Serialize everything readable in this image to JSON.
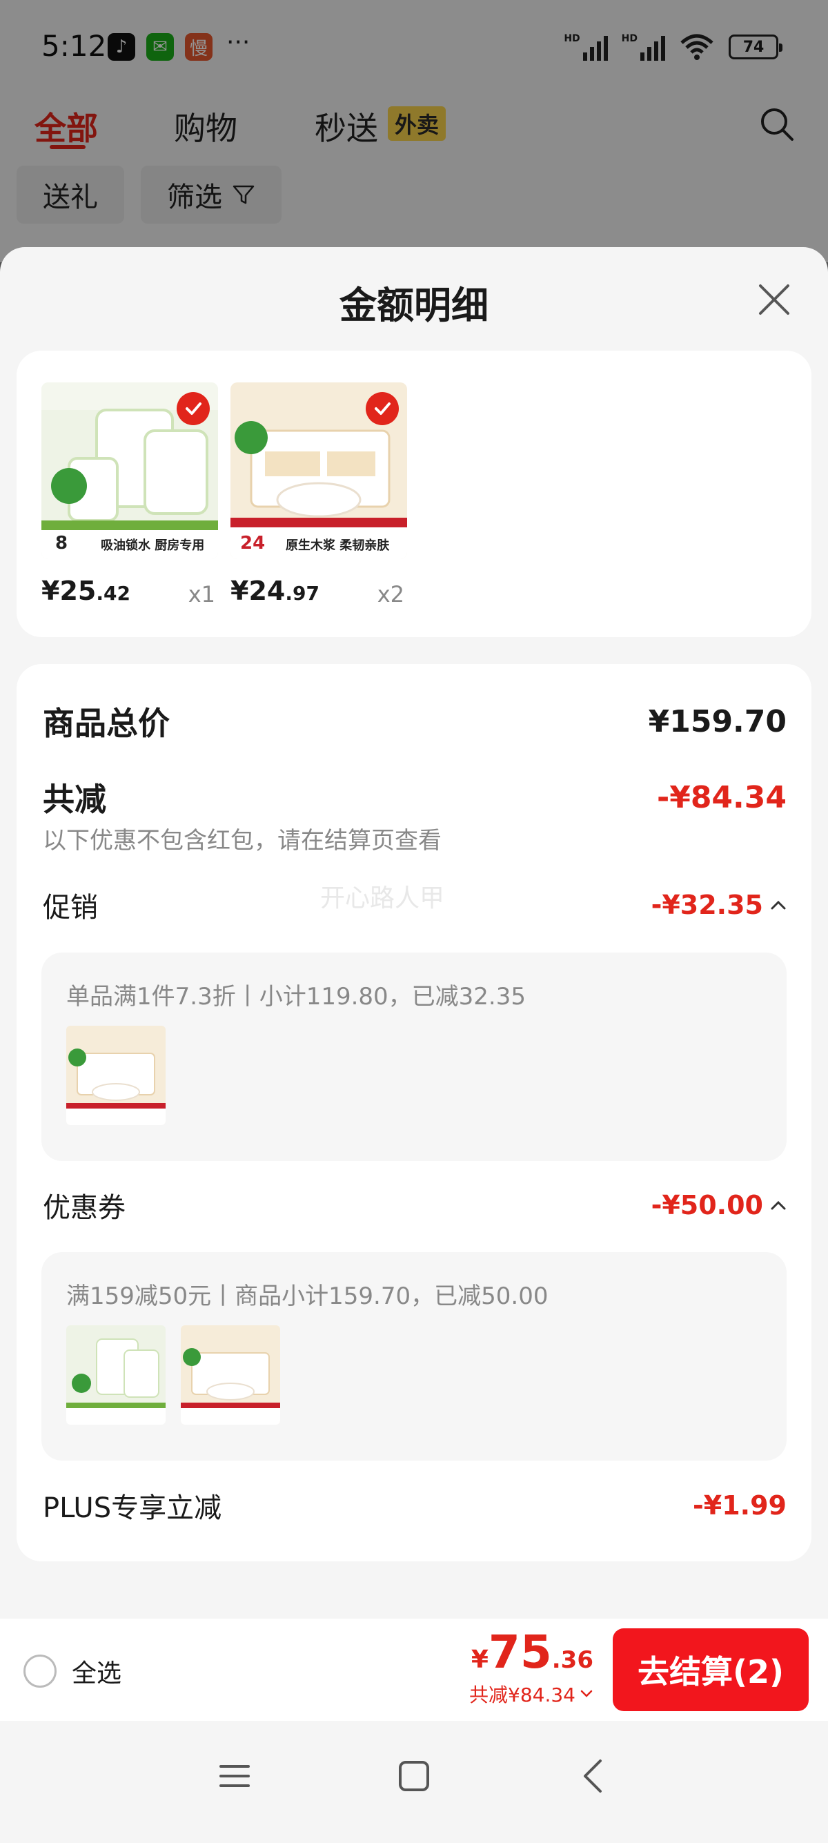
{
  "status_bar": {
    "time": "5:12",
    "apps": [
      {
        "icon": "tiktok-icon",
        "glyph": "♪"
      },
      {
        "icon": "wechat-icon",
        "glyph": "✉"
      },
      {
        "icon": "app-icon",
        "glyph": "慢"
      }
    ],
    "more": "···",
    "battery": "74"
  },
  "background_page": {
    "tabs": [
      {
        "label": "全部",
        "active": true
      },
      {
        "label": "购物",
        "active": false
      },
      {
        "label": "秒送",
        "active": false
      }
    ],
    "tab_badge": "外卖",
    "chips": [
      {
        "label": "送礼"
      },
      {
        "label": "筛选"
      }
    ]
  },
  "sheet": {
    "title": "金额明细",
    "products": [
      {
        "price_int": "¥25",
        "price_dec": ".42",
        "qty": "x1",
        "banner": "吸油锁水 厨房专用",
        "count": "8"
      },
      {
        "price_int": "¥24",
        "price_dec": ".97",
        "qty": "x2",
        "banner": "原生木浆 柔韧亲肤",
        "count": "24"
      }
    ],
    "summary": {
      "goods_total_label": "商品总价",
      "goods_total_value": "¥159.70",
      "reduction_label": "共减",
      "reduction_value": "-¥84.34",
      "note": "以下优惠不包含红包，请在结算页查看",
      "watermark": "开心路人甲"
    },
    "promotion": {
      "label": "促销",
      "value": "-¥32.35",
      "detail": "单品满1件7.3折丨小计119.80，已减32.35"
    },
    "coupon": {
      "label": "优惠券",
      "value": "-¥50.00",
      "detail": "满159减50元丨商品小计159.70，已减50.00"
    },
    "plus": {
      "label": "PLUS专享立减",
      "value": "-¥1.99"
    }
  },
  "bottom_bar": {
    "select_all": "全选",
    "total_yen": "¥",
    "total_int": "75",
    "total_dec": ".36",
    "total_discount": "共减¥84.34",
    "checkout_label": "去结算(2)"
  },
  "colors": {
    "accent": "#e1251b",
    "checkout": "#f2161d"
  }
}
